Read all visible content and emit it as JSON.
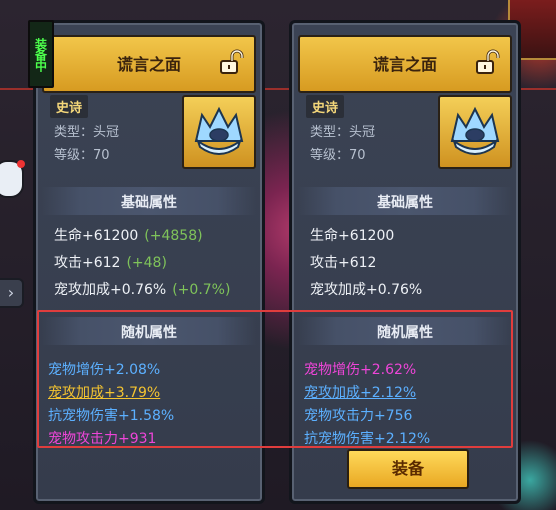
{
  "equipped_tag": "装备中",
  "equip_button": "装备",
  "left_card": {
    "name": "谎言之面",
    "rarity": "史诗",
    "type_line": "类型：头冠",
    "level_line": "等级：70",
    "base_header": "基础属性",
    "base_stats": [
      {
        "text": "生命+61200",
        "bonus": "(+4858)"
      },
      {
        "text": "攻击+612",
        "bonus": "(+48)"
      },
      {
        "text": "宠攻加成+0.76%",
        "bonus": "(+0.7%)"
      }
    ],
    "random_header": "随机属性",
    "random_stats": [
      {
        "text": "宠物增伤+2.08%",
        "color": "#5cb0ff"
      },
      {
        "text": "宠攻加成+3.79%",
        "color": "#f4c430"
      },
      {
        "text": "抗宠物伤害+1.58%",
        "color": "#5cb0ff"
      },
      {
        "text": "宠物攻击力+931",
        "color": "#ee45d8"
      }
    ]
  },
  "right_card": {
    "name": "谎言之面",
    "rarity": "史诗",
    "type_line": "类型：头冠",
    "level_line": "等级：70",
    "base_header": "基础属性",
    "base_stats": [
      {
        "text": "生命+61200"
      },
      {
        "text": "攻击+612"
      },
      {
        "text": "宠攻加成+0.76%"
      }
    ],
    "random_header": "随机属性",
    "random_stats": [
      {
        "text": "宠物增伤+2.62%",
        "color": "#ee45d8"
      },
      {
        "text": "宠攻加成+2.12%",
        "color": "#5cb0ff"
      },
      {
        "text": "宠物攻击力+756",
        "color": "#5cb0ff"
      },
      {
        "text": "抗宠物伤害+2.12%",
        "color": "#5cb0ff"
      }
    ]
  }
}
